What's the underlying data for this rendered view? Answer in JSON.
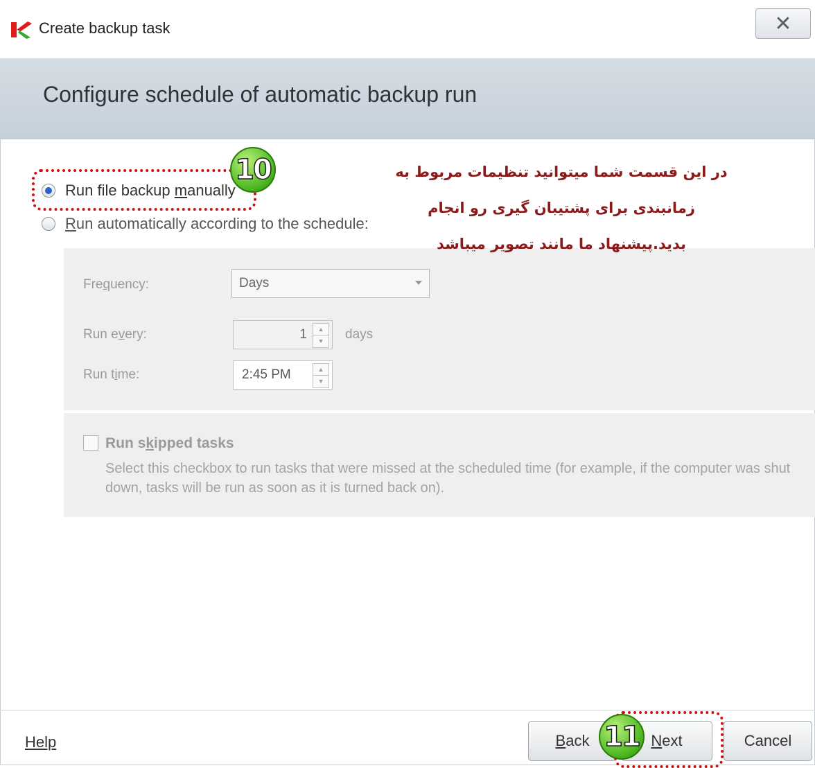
{
  "window": {
    "title": "Create backup task",
    "close_glyph": "✕",
    "logo_icon": "kaspersky-logo-icon"
  },
  "header": {
    "title": "Configure schedule of automatic backup run"
  },
  "options": {
    "manual_pre": "Run file backup ",
    "manual_u": "m",
    "manual_post": "anually",
    "auto_u": "R",
    "auto_post": "un automatically according to the schedule:",
    "selected": "manual"
  },
  "schedule": {
    "frequency_pre": "Fre",
    "frequency_u": "q",
    "frequency_post": "uency:",
    "frequency_value": "Days",
    "run_every_pre": "Run e",
    "run_every_u": "v",
    "run_every_post": "ery:",
    "run_every_value": "1",
    "run_every_unit": "days",
    "run_time_pre": "Run t",
    "run_time_u": "i",
    "run_time_post": "me:",
    "run_time_value": "2:45 PM"
  },
  "skipped": {
    "label_pre": "Run s",
    "label_u": "k",
    "label_post": "ipped tasks",
    "description": "Select this checkbox to run tasks that were missed at the scheduled time (for example, if the computer was shut down, tasks will be run as soon as it is turned back on).",
    "checked": false
  },
  "annotation": {
    "line1": "در این قسمت شما میتوانید تنظیمات مربوط به",
    "line2": "زمانبندی برای پشتیبان گیری رو انجام",
    "line3": "بدید.پیشنهاد ما مانند تصویر میباشد",
    "badge1": "10",
    "badge2": "11",
    "highlight_color": "#d01010",
    "badge_color": "#49b51c"
  },
  "footer": {
    "help": "Help",
    "back_u": "B",
    "back_post": "ack",
    "next_u": "N",
    "next_post": "ext",
    "cancel": "Cancel"
  }
}
